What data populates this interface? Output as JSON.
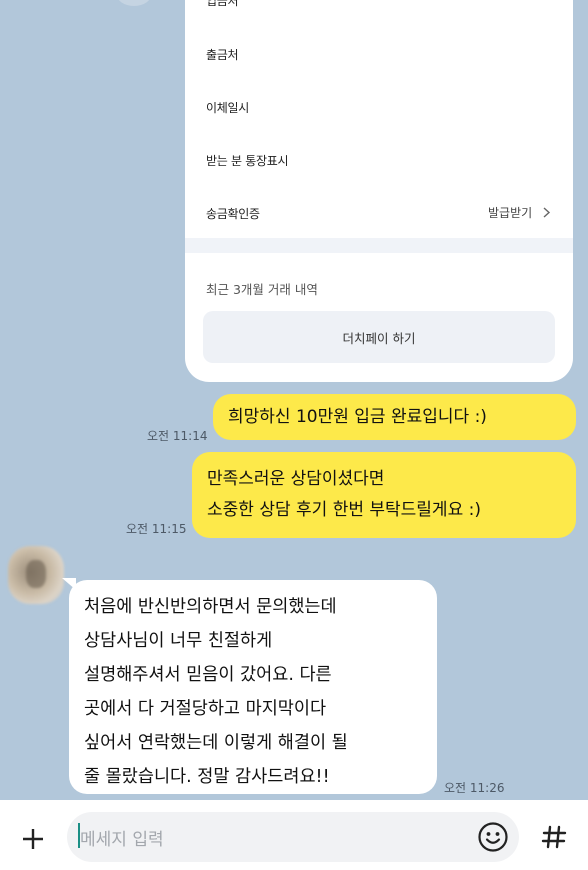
{
  "receipt_card": {
    "rows": [
      {
        "label": "입금처"
      },
      {
        "label": "출금처"
      },
      {
        "label": "이체일시"
      },
      {
        "label": "받는 분 통장표시"
      },
      {
        "label": "송금확인증",
        "action": "발급받기"
      }
    ],
    "recent_title": "최근 3개월 거래 내역",
    "button_label": "더치페이 하기"
  },
  "messages": [
    {
      "side": "out",
      "text": "희망하신 10만원 입금 완료입니다 :)",
      "time": "오전 11:14"
    },
    {
      "side": "out",
      "lines": [
        "만족스러운 상담이셨다면",
        "소중한 상담 후기 한번 부탁드릴게요 :)"
      ],
      "time": "오전 11:15"
    },
    {
      "side": "in",
      "lines": [
        "처음에 반신반의하면서 문의했는데",
        "상담사님이 너무 친절하게",
        "설명해주셔서 믿음이 갔어요. 다른",
        "곳에서 다 거절당하고 마지막이다",
        "싶어서 연락했는데 이렇게 해결이 될",
        "줄 몰랐습니다. 정말 감사드려요!!"
      ],
      "time": "오전 11:26"
    }
  ],
  "composer": {
    "placeholder": "메세지 입력",
    "plus_icon": "plus-icon",
    "emoji_icon": "emoji-icon",
    "hash_icon": "hash-icon"
  },
  "colors": {
    "background": "#b2c7da",
    "my_bubble": "#fde94a",
    "their_bubble": "#ffffff"
  }
}
